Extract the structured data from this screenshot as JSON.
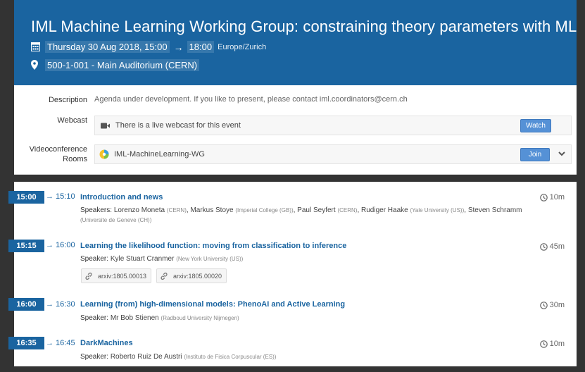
{
  "event": {
    "title": "IML Machine Learning Working Group: constraining theory parameters with ML",
    "date_start": "Thursday 30 Aug 2018, 15:00",
    "arrow": "→",
    "time_end": "18:00",
    "timezone": "Europe/Zurich",
    "location": "500-1-001 - Main Auditorium (CERN)"
  },
  "details": {
    "description_label": "Description",
    "description_text": "Agenda under development. If you like to present, please contact iml.coordinators@cern.ch",
    "webcast_label": "Webcast",
    "webcast_text": "There is a live webcast for this event",
    "watch_label": "Watch",
    "vc_label_1": "Videoconference",
    "vc_label_2": "Rooms",
    "vc_room": "IML-MachineLearning-WG",
    "join_label": "Join"
  },
  "timetable": [
    {
      "start": "15:00",
      "end": "→ 15:10",
      "title": "Introduction and news",
      "duration": "10m",
      "speaker_label": "Speakers",
      "speakers": [
        {
          "name": "Lorenzo Moneta",
          "aff": "(CERN)"
        },
        {
          "name": "Markus Stoye",
          "aff": "(Imperial College (GB))"
        },
        {
          "name": "Paul Seyfert",
          "aff": "(CERN)"
        },
        {
          "name": "Rudiger Haake",
          "aff": "(Yale University (US))"
        },
        {
          "name": "Steven Schramm",
          "aff": "(Universite de Geneve (CH))"
        }
      ]
    },
    {
      "start": "15:15",
      "end": "→ 16:00",
      "title": "Learning the likelihood function: moving from classification to inference",
      "duration": "45m",
      "speaker_label": "Speaker",
      "speakers": [
        {
          "name": "Kyle Stuart Cranmer",
          "aff": "(New York University (US))"
        }
      ],
      "attachments": [
        "arxiv:1805.00013",
        "arxiv:1805.00020"
      ]
    },
    {
      "start": "16:00",
      "end": "→ 16:30",
      "title": "Learning (from) high-dimensional models: PhenoAI and Active Learning",
      "duration": "30m",
      "speaker_label": "Speaker",
      "speakers": [
        {
          "name": "Mr Bob Stienen",
          "aff": "(Radboud University Nijmegen)"
        }
      ]
    },
    {
      "start": "16:35",
      "end": "→ 16:45",
      "title": "DarkMachines",
      "duration": "10m",
      "speaker_label": "Speaker",
      "speakers": [
        {
          "name": "Roberto Ruiz De Austri",
          "aff": "(Instituto de Fisica Corpuscular (ES))"
        }
      ]
    }
  ],
  "colors": {
    "primary": "#1a64a0",
    "button": "#5591d6",
    "background": "#333333"
  },
  "icons": [
    "calendar-icon",
    "map-pin-icon",
    "video-camera-icon",
    "vidyo-icon",
    "chevron-down-icon",
    "clock-icon",
    "link-icon"
  ]
}
